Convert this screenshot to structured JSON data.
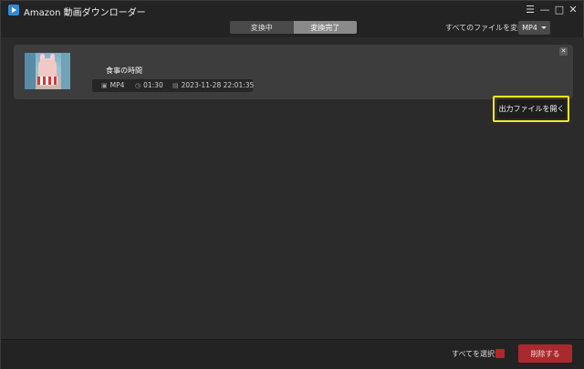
{
  "app": {
    "title": "Amazon 動画ダウンローダー"
  },
  "window_controls": {
    "menu_icon": "menu-icon",
    "minimize_icon": "minimize-icon",
    "maximize_icon": "maximize-icon",
    "close_icon": "close-icon"
  },
  "tabs": [
    {
      "label": "変換中",
      "active": false
    },
    {
      "label": "変換完了",
      "active": true
    }
  ],
  "convert_all": {
    "label": "すべてのファイルを変換:",
    "selected_format": "MP4"
  },
  "items": [
    {
      "title": "食事の時間",
      "format": "MP4",
      "duration": "01:30",
      "date": "2023-11-28 22:01:35",
      "open_output_label": "出力ファイルを開く"
    }
  ],
  "footer": {
    "select_all_label": "すべてを選択:",
    "delete_label": "削除する"
  },
  "colors": {
    "accent_red": "#a82a2f",
    "highlight_yellow": "#f3ea1b",
    "app_icon_blue": "#2f8bd9"
  }
}
